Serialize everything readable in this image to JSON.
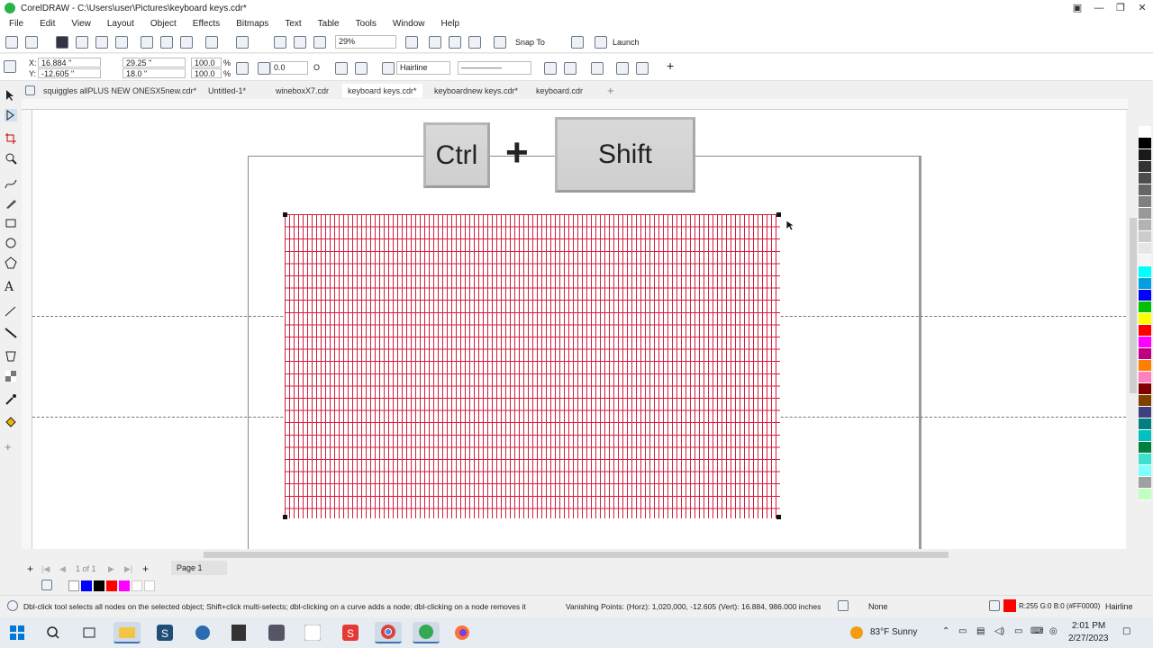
{
  "window": {
    "title": "CorelDRAW - C:\\Users\\user\\Pictures\\keyboard keys.cdr*"
  },
  "menu": [
    "File",
    "Edit",
    "View",
    "Layout",
    "Object",
    "Effects",
    "Bitmaps",
    "Text",
    "Table",
    "Tools",
    "Window",
    "Help"
  ],
  "toolbar": {
    "zoom_value": "29%",
    "snap_to_label": "Snap To",
    "launch_label": "Launch"
  },
  "property_bar": {
    "x_value": "16.884 \"",
    "y_value": "-12.605 \"",
    "width_value": "29.25 \"",
    "height_value": "18.0 \"",
    "scale_x": "100.0",
    "scale_y": "100.0",
    "percent_sign": "%",
    "rotation_value": "0.0",
    "rotation_unit": "O",
    "outline_width": "Hairline"
  },
  "tabs": [
    {
      "label": "squiggles allPLUS NEW ONESX5new.cdr*",
      "active": false
    },
    {
      "label": "Untitled-1*",
      "active": false
    },
    {
      "label": "wineboxX7.cdr",
      "active": false
    },
    {
      "label": "keyboard keys.cdr*",
      "active": true
    },
    {
      "label": "keyboardnew keys.cdr*",
      "active": false
    },
    {
      "label": "keyboard.cdr",
      "active": false
    }
  ],
  "canvas": {
    "key_ctrl_label": "Ctrl",
    "plus_label": "+",
    "key_shift_label": "Shift"
  },
  "page_nav": {
    "page_count": "1 of 1",
    "page_tab": "Page 1"
  },
  "status": {
    "hint": "Dbl-click tool selects all nodes on the selected object; Shift+click multi-selects; dbl-clicking on a curve adds a node; dbl-clicking on a node removes it",
    "vanishing_points": "Vanishing Points: (Horz): 1,020,000, -12.605  (Vert): 16.884, 986.000  inches",
    "fill_label": "None",
    "outline_color": "R:255 G:0 B:0 (#FF0000)",
    "outline_width": "Hairline"
  },
  "taskbar": {
    "weather": "83°F  Sunny",
    "time": "2:01 PM",
    "date": "2/27/2023"
  },
  "colors": {
    "grid_line": "#d21f3c",
    "accent": "#3b73b9",
    "outline_swatch": "#FF0000"
  },
  "palette": [
    "#ffffff",
    "#000000",
    "#1a1a1a",
    "#333333",
    "#4d4d4d",
    "#666666",
    "#808080",
    "#999999",
    "#b3b3b3",
    "#cccccc",
    "#e6e6e6",
    "#f5f5f5",
    "#00ffff",
    "#00a0e0",
    "#0000ff",
    "#00c000",
    "#ffff00",
    "#ff0000",
    "#ff00ff",
    "#c00080",
    "#ff8000",
    "#ff80c0",
    "#800000",
    "#804000",
    "#404080",
    "#008080",
    "#00c0c0",
    "#008040",
    "#40e0d0",
    "#80ffff",
    "#a0a0a0",
    "#c0ffc0"
  ]
}
